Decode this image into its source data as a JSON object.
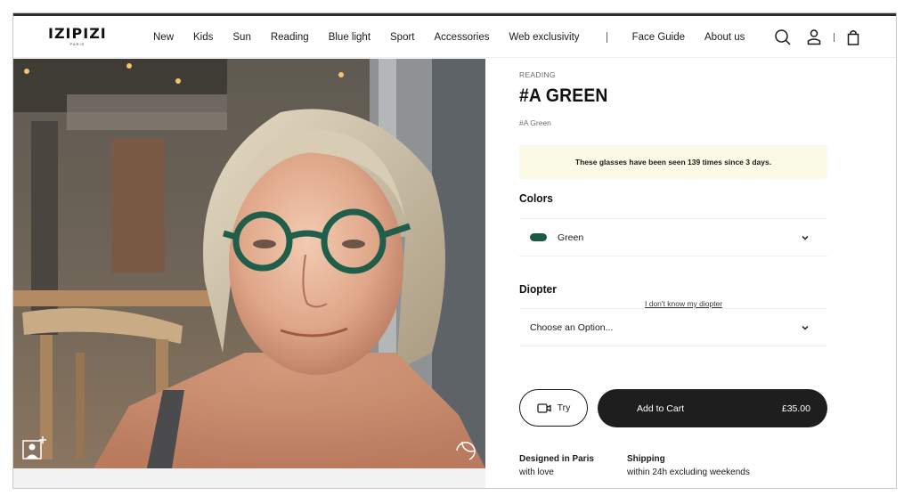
{
  "brand": {
    "name": "IZIPIZI",
    "sub": "PARIS"
  },
  "nav": {
    "items": [
      "New",
      "Kids",
      "Sun",
      "Reading",
      "Blue light",
      "Sport",
      "Accessories",
      "Web exclusivity"
    ],
    "secondary": [
      "Face Guide",
      "About us"
    ]
  },
  "header_icons": [
    "search-icon",
    "account-icon",
    "bag-icon"
  ],
  "product": {
    "breadcrumb": "READING",
    "title": "#A GREEN",
    "subtitle": "#A Green",
    "notice": "These glasses have been seen 139 times since 3 days.",
    "colors_label": "Colors",
    "color_value": "Green",
    "color_hex": "#1d5a46",
    "diopter_label": "Diopter",
    "diopter_help": "I don't know my diopter",
    "diopter_placeholder": "Choose an Option...",
    "try_label": "Try",
    "cart_label": "Add to Cart",
    "price": "£35.00"
  },
  "info": {
    "designed_title": "Designed in Paris",
    "designed_text": "with love",
    "shipping_title": "Shipping",
    "shipping_text": "within 24h excluding weekends"
  },
  "photo_icons": [
    "add-photo-icon",
    "rotate-icon"
  ]
}
